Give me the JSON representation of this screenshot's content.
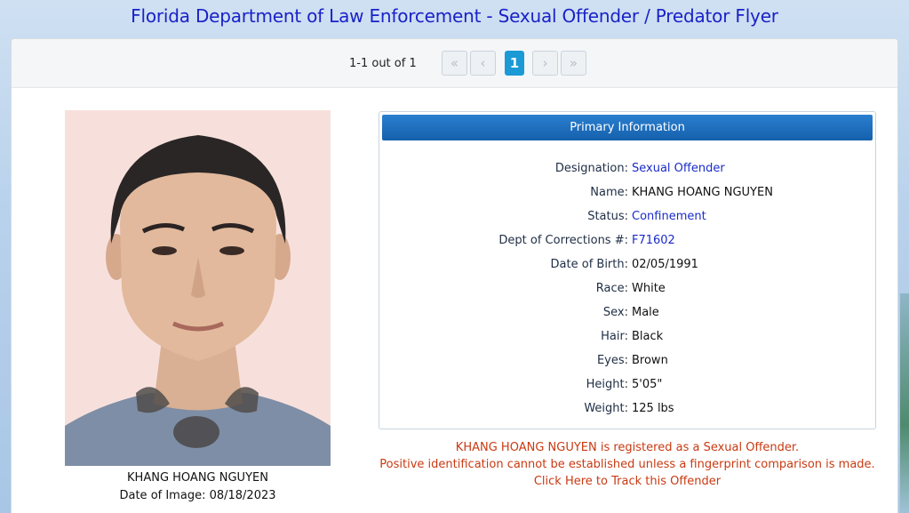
{
  "page": {
    "title": "Florida Department of Law Enforcement - Sexual Offender / Predator Flyer"
  },
  "pager": {
    "count_text": "1-1 out of 1",
    "first": "«",
    "prev": "‹",
    "current": "1",
    "next": "›",
    "last": "»"
  },
  "photo": {
    "name": "KHANG HOANG NGUYEN",
    "date_text": "Date of Image: 08/18/2023"
  },
  "primary": {
    "heading": "Primary Information",
    "rows": [
      {
        "label": "Designation:",
        "value": "Sexual Offender"
      },
      {
        "label": "Name:",
        "value": "KHANG HOANG NGUYEN"
      },
      {
        "label": "Status:",
        "value": "Confinement"
      },
      {
        "label": "Dept of Corrections #:",
        "value": "F71602"
      },
      {
        "label": "Date of Birth:",
        "value": "02/05/1991"
      },
      {
        "label": "Race:",
        "value": "White"
      },
      {
        "label": "Sex:",
        "value": "Male"
      },
      {
        "label": "Hair:",
        "value": "Black"
      },
      {
        "label": "Eyes:",
        "value": "Brown"
      },
      {
        "label": "Height:",
        "value": "5'05\""
      },
      {
        "label": "Weight:",
        "value": "125 lbs"
      }
    ]
  },
  "notice": {
    "line1": "KHANG HOANG NGUYEN is registered as a Sexual Offender.",
    "line2": "Positive identification cannot be established unless a fingerprint comparison is made.",
    "track_link": "Click Here to Track this Offender"
  }
}
